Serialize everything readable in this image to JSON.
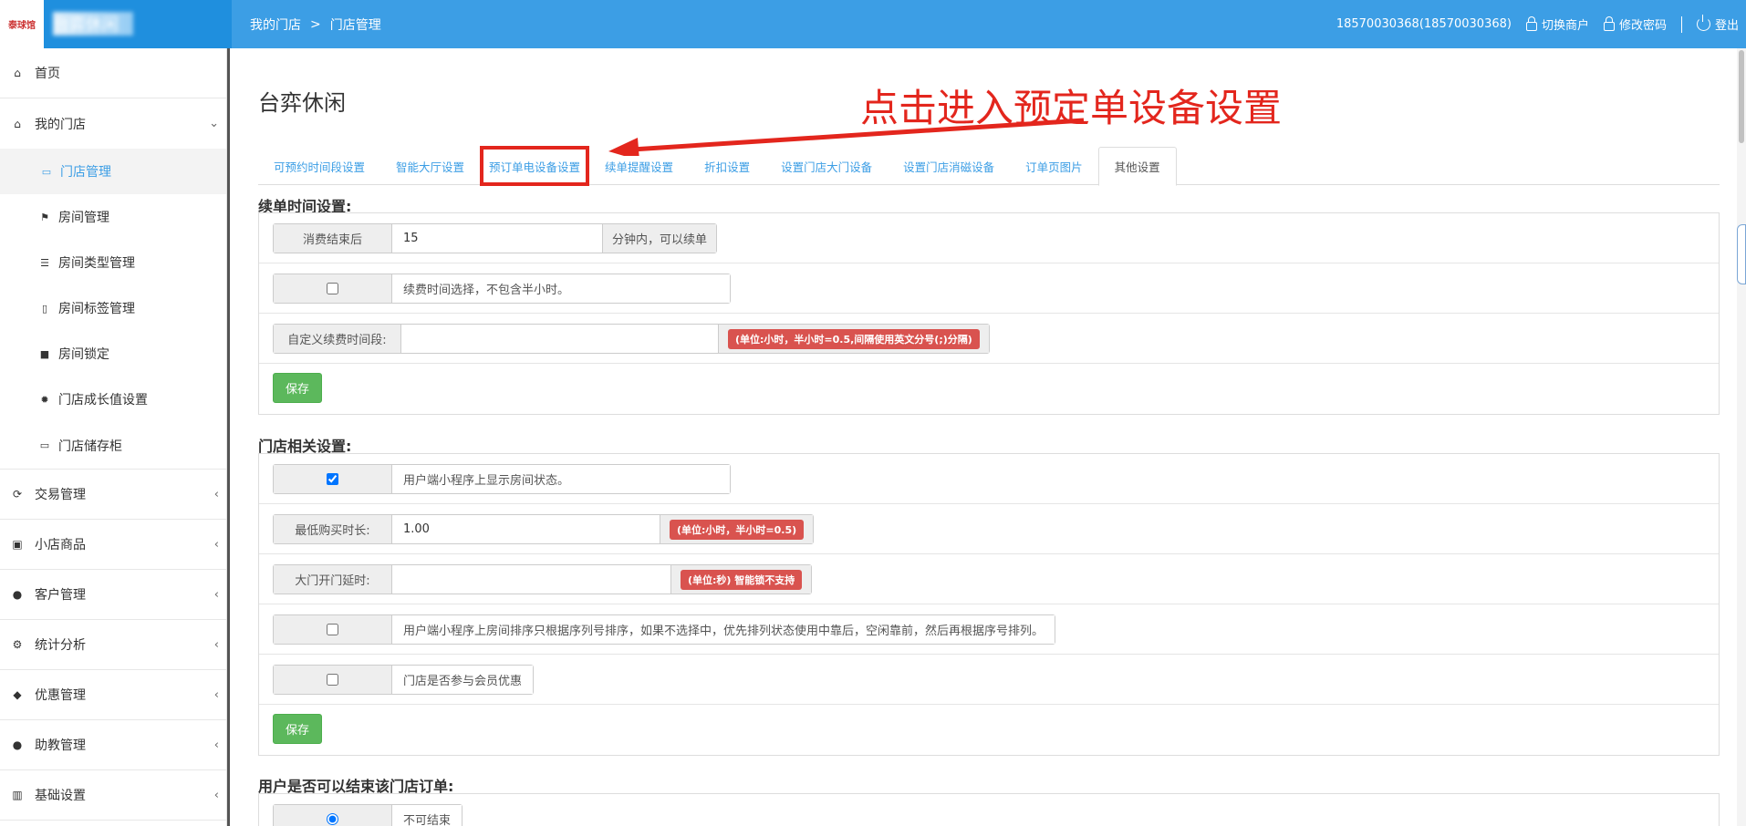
{
  "header": {
    "logo_text": "泰球馆",
    "brand_name": "台弈休闲",
    "breadcrumb": [
      "我的门店",
      ">",
      "门店管理"
    ],
    "user": "18570030368(18570030368)",
    "switch_merchant": "切换商户",
    "change_password": "修改密码",
    "logout": "登出"
  },
  "sidebar": {
    "home": "首页",
    "my_store": "我的门店",
    "sub_items": [
      "门店管理",
      "房间管理",
      "房间类型管理",
      "房间标签管理",
      "房间锁定",
      "门店成长值设置",
      "门店储存柜"
    ],
    "groups": [
      "交易管理",
      "小店商品",
      "客户管理",
      "统计分析",
      "优惠管理",
      "助教管理",
      "基础设置"
    ]
  },
  "page": {
    "title": "台弈休闲",
    "annotation": "点击进入预定单设备设置",
    "tabs": [
      "可预约时间段设置",
      "智能大厅设置",
      "预订单电设备设置",
      "续单提醒设置",
      "折扣设置",
      "设置门店大门设备",
      "设置门店消磁设备",
      "订单页图片",
      "其他设置"
    ]
  },
  "renew": {
    "title": "续单时间设置:",
    "after_label": "消费结束后",
    "after_value": "15",
    "after_suffix": "分钟内，可以续单",
    "half_hour_label": "续费时间选择，不包含半小时。",
    "custom_label": "自定义续费时间段:",
    "custom_value": "",
    "custom_hint": "(单位:小时，半小时=0.5,间隔使用英文分号(;)分隔)",
    "save": "保存"
  },
  "store": {
    "title": "门店相关设置:",
    "show_status_label": "用户端小程序上显示房间状态。",
    "min_buy_label": "最低购买时长:",
    "min_buy_value": "1.00",
    "min_buy_hint": "(单位:小时，半小时=0.5)",
    "door_delay_label": "大门开门延时:",
    "door_delay_value": "",
    "door_delay_hint": "(单位:秒) 智能锁不支持",
    "sort_label": "用户端小程序上房间排序只根据序列号排序，如果不选择中，优先排列状态使用中靠后，空闲靠前，然后再根据序号排列。",
    "member_label": "门店是否参与会员优惠",
    "save": "保存"
  },
  "finish": {
    "title": "用户是否可以结束该门店订单:",
    "option_label": "不可结束"
  }
}
